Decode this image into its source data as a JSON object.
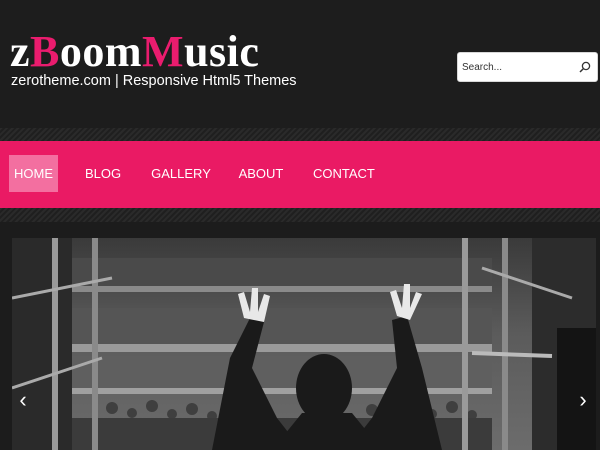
{
  "header": {
    "logo": {
      "part1": "z",
      "part2": "B",
      "part3": "oom",
      "part4": "M",
      "part5": "usic"
    },
    "tagline": "zerotheme.com | Responsive Html5 Themes",
    "search": {
      "placeholder": "Search..."
    }
  },
  "nav": {
    "items": [
      {
        "label": "HOME",
        "active": true
      },
      {
        "label": "BLOG"
      },
      {
        "label": "GALLERY"
      },
      {
        "label": "ABOUT"
      },
      {
        "label": "CONTACT"
      }
    ]
  },
  "slider": {
    "prev": "‹",
    "next": "›"
  },
  "colors": {
    "accent": "#ea1a64",
    "active_nav": "#f36fa0",
    "background": "#1c1c1c"
  }
}
